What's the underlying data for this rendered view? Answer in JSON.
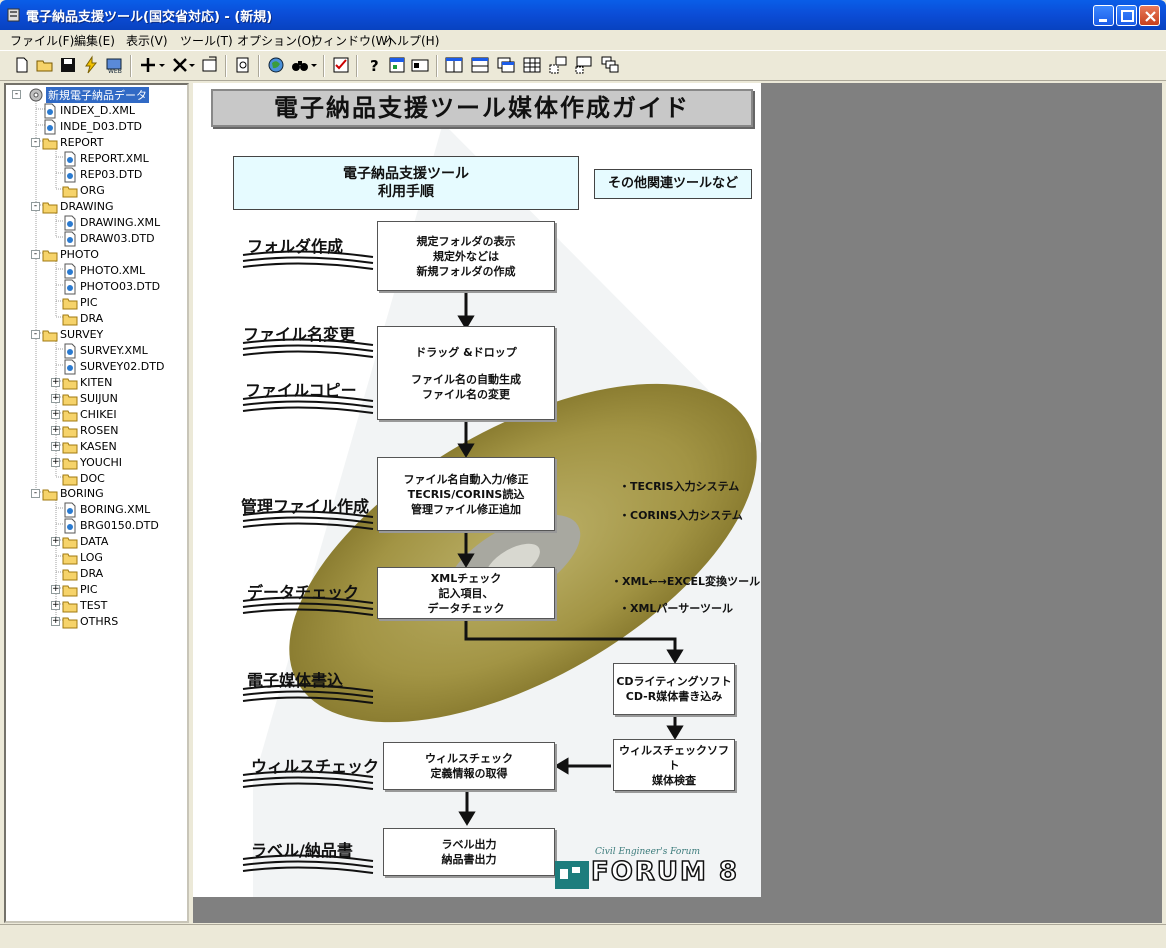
{
  "window": {
    "title": "電子納品支援ツール(国交省対応) - (新規)"
  },
  "menu": [
    "ファイル(F)",
    "編集(E)",
    "表示(V)",
    "ツール(T)",
    "オプション(O)",
    "ウィンドウ(W)",
    "ヘルプ(H)"
  ],
  "tree": {
    "root": "新規電子納品データ",
    "items": [
      {
        "label": "INDEX_D.XML"
      },
      {
        "label": "INDE_D03.DTD"
      },
      {
        "label": "REPORT"
      },
      {
        "label": "REPORT.XML"
      },
      {
        "label": "REP03.DTD"
      },
      {
        "label": "ORG"
      },
      {
        "label": "DRAWING"
      },
      {
        "label": "DRAWING.XML"
      },
      {
        "label": "DRAW03.DTD"
      },
      {
        "label": "PHOTO"
      },
      {
        "label": "PHOTO.XML"
      },
      {
        "label": "PHOTO03.DTD"
      },
      {
        "label": "PIC"
      },
      {
        "label": "DRA"
      },
      {
        "label": "SURVEY"
      },
      {
        "label": "SURVEY.XML"
      },
      {
        "label": "SURVEY02.DTD"
      },
      {
        "label": "KITEN"
      },
      {
        "label": "SUIJUN"
      },
      {
        "label": "CHIKEI"
      },
      {
        "label": "ROSEN"
      },
      {
        "label": "KASEN"
      },
      {
        "label": "YOUCHI"
      },
      {
        "label": "DOC"
      },
      {
        "label": "BORING"
      },
      {
        "label": "BORING.XML"
      },
      {
        "label": "BRG0150.DTD"
      },
      {
        "label": "DATA"
      },
      {
        "label": "LOG"
      },
      {
        "label": "DRA"
      },
      {
        "label": "PIC"
      },
      {
        "label": "TEST"
      },
      {
        "label": "OTHRS"
      }
    ]
  },
  "guide": {
    "title": "電子納品支援ツール媒体作成ガイド",
    "header_main": [
      "電子納品支援ツール",
      "利用手順"
    ],
    "header_other": "その他関連ツールなど",
    "stages": {
      "folder": "フォルダ作成",
      "rename": "ファイル名変更",
      "copy": "ファイルコピー",
      "mgmt": "管理ファイル作成",
      "check": "データチェック",
      "write": "電子媒体書込",
      "virus": "ウィルスチェック",
      "label": "ラベル/納品書"
    },
    "boxes": {
      "folder": [
        "規定フォルダの表示",
        "規定外などは",
        "新規フォルダの作成"
      ],
      "drag": [
        "ドラッグ &ドロップ",
        "",
        "ファイル名の自動生成",
        "ファイル名の変更"
      ],
      "mgmt": [
        "ファイル名自動入力/修正",
        "TECRIS/CORINS読込",
        "管理ファイル修正追加"
      ],
      "xml": [
        "XMLチェック",
        "記入項目、",
        "データチェック"
      ],
      "cd": [
        "CDライティングソフト",
        "CD-R媒体書き込み"
      ],
      "virus_soft": [
        "ウィルスチェックソフト",
        "媒体検査"
      ],
      "virus_def": [
        "ウィルスチェック",
        "定義情報の取得"
      ],
      "label_out": [
        "ラベル出力",
        "納品書出力"
      ]
    },
    "notes": {
      "tecris": "・TECRIS入力システム",
      "corins": "・CORINS入力システム",
      "excel": "・XML←→EXCEL変換ツール",
      "parser": "・XMLパーサーツール"
    },
    "logo": {
      "tagline": "Civil Engineer's Forum",
      "name": "FORUM 8"
    }
  }
}
